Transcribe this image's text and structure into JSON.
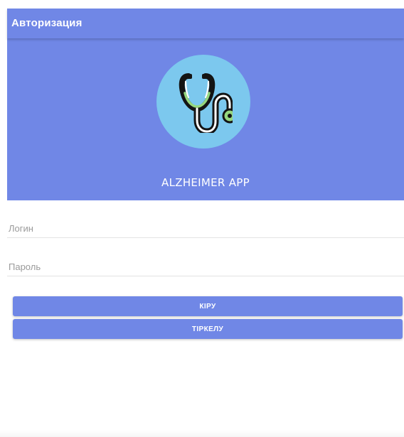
{
  "appbar": {
    "title": "Авторизация"
  },
  "hero": {
    "logo_icon": "stethoscope-icon",
    "app_name": "ALZHEIMER APP"
  },
  "form": {
    "login_placeholder": "Логин",
    "password_placeholder": "Пароль",
    "login_value": "",
    "password_value": ""
  },
  "buttons": {
    "login_label": "КІРУ",
    "register_label": "ТІРКЕЛУ"
  },
  "colors": {
    "primary": "#7087e6",
    "logo_circle": "#7cc8ee",
    "stethoscope_tube": "#96d77e",
    "stethoscope_outline": "#141414"
  }
}
